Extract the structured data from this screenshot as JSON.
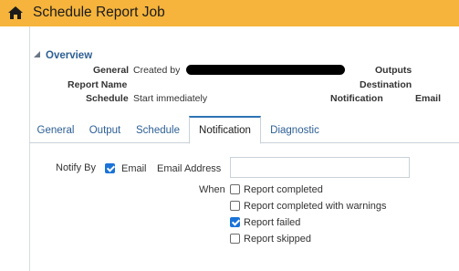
{
  "header": {
    "title": "Schedule Report Job",
    "home_icon": "home-icon"
  },
  "overview": {
    "title": "Overview",
    "fields": [
      {
        "label": "General",
        "value": "Created by"
      },
      {
        "label": "Report Name",
        "value": ""
      },
      {
        "label": "Schedule",
        "value": "Start immediately"
      }
    ],
    "right_fields": [
      {
        "label": "Outputs"
      },
      {
        "label": "Destination"
      },
      {
        "label": "Notification",
        "value": "Email"
      }
    ]
  },
  "tabs": [
    {
      "label": "General",
      "active": false
    },
    {
      "label": "Output",
      "active": false
    },
    {
      "label": "Schedule",
      "active": false
    },
    {
      "label": "Notification",
      "active": true
    },
    {
      "label": "Diagnostic",
      "active": false
    }
  ],
  "notification": {
    "notify_by_label": "Notify By",
    "email_checkbox": {
      "label": "Email",
      "checked": true
    },
    "email_address_label": "Email Address",
    "email_address_value": "",
    "when_label": "When",
    "conditions": [
      {
        "label": "Report completed",
        "checked": false
      },
      {
        "label": "Report completed with warnings",
        "checked": false
      },
      {
        "label": "Report failed",
        "checked": true
      },
      {
        "label": "Report skipped",
        "checked": false
      }
    ]
  },
  "colors": {
    "header_bg": "#f6b43c",
    "link_blue": "#2d5f94",
    "tab_active_accent": "#2d73b4",
    "checkbox_blue": "#1a73d8"
  }
}
